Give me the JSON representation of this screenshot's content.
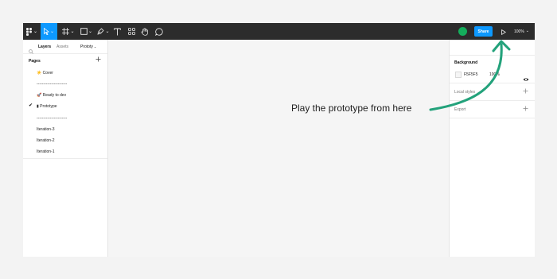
{
  "toolbar": {
    "share_label": "Share",
    "zoom_value": "100%",
    "tool_icons": [
      "figma-main-menu-icon",
      "move-tool-icon",
      "frame-tool-icon",
      "shape-tool-icon",
      "pen-tool-icon",
      "text-tool-icon",
      "components-icon",
      "hand-tool-icon",
      "comment-tool-icon"
    ],
    "colors": {
      "background": "#2c2c2c",
      "active_tool": "#0d99ff",
      "share_button": "#0d99ff",
      "avatar": "#14ae5c"
    }
  },
  "left_panel": {
    "tabs": [
      "Layers",
      "Assets"
    ],
    "page_selector": "Prototy",
    "pages_header": "Pages",
    "pages": [
      {
        "label": "☀️ Cover",
        "selected": false
      },
      {
        "label": "-----------------------",
        "selected": false
      },
      {
        "label": "🚀 Ready to dev",
        "selected": false
      },
      {
        "label": "▮ Prototype",
        "selected": true
      },
      {
        "label": "-----------------------",
        "selected": false
      },
      {
        "label": "Iteration-3",
        "selected": false
      },
      {
        "label": "Iteration-2",
        "selected": false
      },
      {
        "label": "Iteration-1",
        "selected": false
      }
    ]
  },
  "right_panel": {
    "background_title": "Background",
    "background_hex": "F5F5F5",
    "background_opacity": "100%",
    "local_styles": "Local styles",
    "export_label": "Export",
    "background_color": "#f5f5f5"
  },
  "canvas": {
    "callout_text": "Play the prototype from here",
    "arrow_color": "#23a27b"
  }
}
